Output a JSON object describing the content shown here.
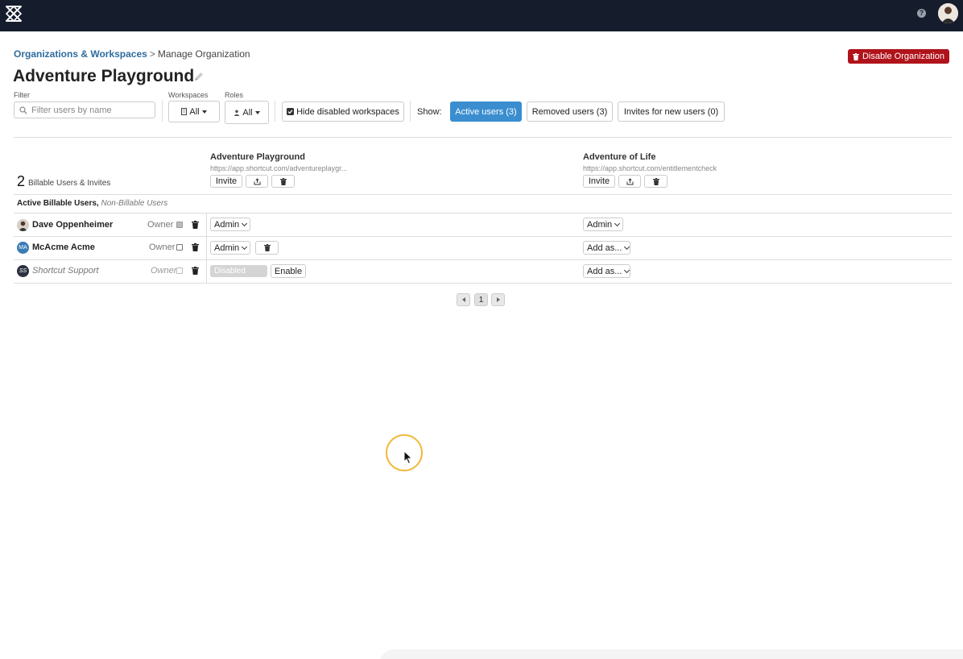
{
  "header": {
    "logo_icon": "shortcut-logo-icon",
    "help_icon": "question-icon",
    "help_glyph": "?",
    "avatar_icon": "user-avatar-icon"
  },
  "breadcrumb": {
    "parent": "Organizations & Workspaces",
    "separator": ">",
    "current": "Manage Organization"
  },
  "page": {
    "title": "Adventure Playground",
    "edit_icon": "pencil-icon",
    "disable_button": "Disable Organization",
    "disable_color": "#b0131b"
  },
  "filters": {
    "filter_label": "Filter",
    "filter_placeholder": "Filter users by name",
    "workspaces_label": "Workspaces",
    "workspaces_value": "All",
    "roles_label": "Roles",
    "roles_value": "All",
    "hide_disabled_label": "Hide disabled workspaces",
    "hide_disabled_checked": true,
    "show_label": "Show:",
    "tabs": [
      {
        "label": "Active users (3)",
        "active": true
      },
      {
        "label": "Removed users (3)",
        "active": false
      },
      {
        "label": "Invites for new users (0)",
        "active": false
      }
    ],
    "accent_color": "#3a8ecf"
  },
  "summary": {
    "count": "2",
    "count_label": "Billable Users & Invites",
    "section_bold": "Active Billable Users,",
    "section_italic": "Non-Billable Users"
  },
  "workspaces": [
    {
      "name": "Adventure Playground",
      "url": "https://app.shortcut.com/adventureplaygr...",
      "invite_label": "Invite"
    },
    {
      "name": "Adventure of Life",
      "url": "https://app.shortcut.com/entitlementcheck",
      "invite_label": "Invite"
    }
  ],
  "users": [
    {
      "name": "Dave Oppenheimer",
      "initials": "",
      "role_label": "Owner",
      "owner_checked": true,
      "disabled": false,
      "ws1": "Admin",
      "ws2": "Admin"
    },
    {
      "name": "McAcme Acme",
      "initials": "MA",
      "role_label": "Owner",
      "owner_checked": false,
      "disabled": false,
      "ws1": "Admin",
      "ws2": "Add as..."
    },
    {
      "name": "Shortcut Support",
      "initials": "SS",
      "role_label": "Owner",
      "owner_checked": false,
      "disabled": true,
      "ws1": "Disabled",
      "ws1_action": "Enable",
      "ws2": "Add as..."
    }
  ],
  "pagination": {
    "current_page": "1"
  }
}
